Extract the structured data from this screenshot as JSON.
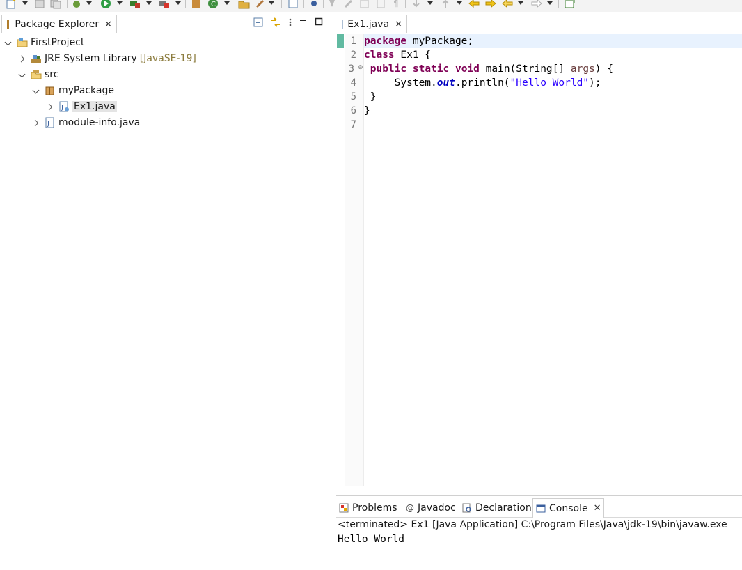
{
  "package_explorer": {
    "tab_label": "Package Explorer",
    "tree": [
      {
        "label": "FirstProject",
        "expanded": true,
        "icon": "project-folder-icon"
      },
      {
        "label": "JRE System Library",
        "decoration": "[JavaSE-19]",
        "expanded": false,
        "icon": "library-icon"
      },
      {
        "label": "src",
        "expanded": true,
        "icon": "source-folder-icon"
      },
      {
        "label": "myPackage",
        "expanded": true,
        "icon": "package-icon"
      },
      {
        "label": "Ex1.java",
        "expanded": false,
        "selected": true,
        "icon": "java-file-icon"
      },
      {
        "label": "module-info.java",
        "expanded": false,
        "icon": "java-file-icon"
      }
    ]
  },
  "editor": {
    "tab_label": "Ex1.java",
    "line_numbers": [
      "1",
      "2",
      "3",
      "4",
      "5",
      "6",
      "7"
    ],
    "lines": [
      [
        {
          "t": "package",
          "c": "kw"
        },
        {
          "t": " myPackage;",
          "c": ""
        }
      ],
      [
        {
          "t": "class",
          "c": "kw"
        },
        {
          "t": " Ex1 {",
          "c": ""
        }
      ],
      [
        {
          "t": " ",
          "c": ""
        },
        {
          "t": "public",
          "c": "kw"
        },
        {
          "t": " ",
          "c": ""
        },
        {
          "t": "static",
          "c": "kw"
        },
        {
          "t": " ",
          "c": ""
        },
        {
          "t": "void",
          "c": "kw"
        },
        {
          "t": " main(String[] ",
          "c": ""
        },
        {
          "t": "args",
          "c": "arg"
        },
        {
          "t": ") {",
          "c": ""
        }
      ],
      [
        {
          "t": "     System.",
          "c": ""
        },
        {
          "t": "out",
          "c": "fld"
        },
        {
          "t": ".println(",
          "c": ""
        },
        {
          "t": "\"Hello World\"",
          "c": "str"
        },
        {
          "t": ");",
          "c": ""
        }
      ],
      [
        {
          "t": " }",
          "c": ""
        }
      ],
      [
        {
          "t": "}",
          "c": ""
        }
      ],
      [
        {
          "t": "",
          "c": ""
        }
      ]
    ]
  },
  "bottom": {
    "tabs": [
      {
        "label": "Problems",
        "icon": "problems-icon"
      },
      {
        "label": "Javadoc",
        "icon": "javadoc-icon"
      },
      {
        "label": "Declaration",
        "icon": "declaration-icon"
      },
      {
        "label": "Console",
        "icon": "console-icon",
        "active": true
      }
    ],
    "console_status": "<terminated> Ex1 [Java Application] C:\\Program Files\\Java\\jdk-19\\bin\\javaw.exe",
    "console_output": "Hello World"
  },
  "colors": {
    "keyword": "#7f0055",
    "string": "#2a00ff",
    "static_field": "#0000c0",
    "argument": "#6a3e3e",
    "current_line": "#e8f2fe"
  }
}
